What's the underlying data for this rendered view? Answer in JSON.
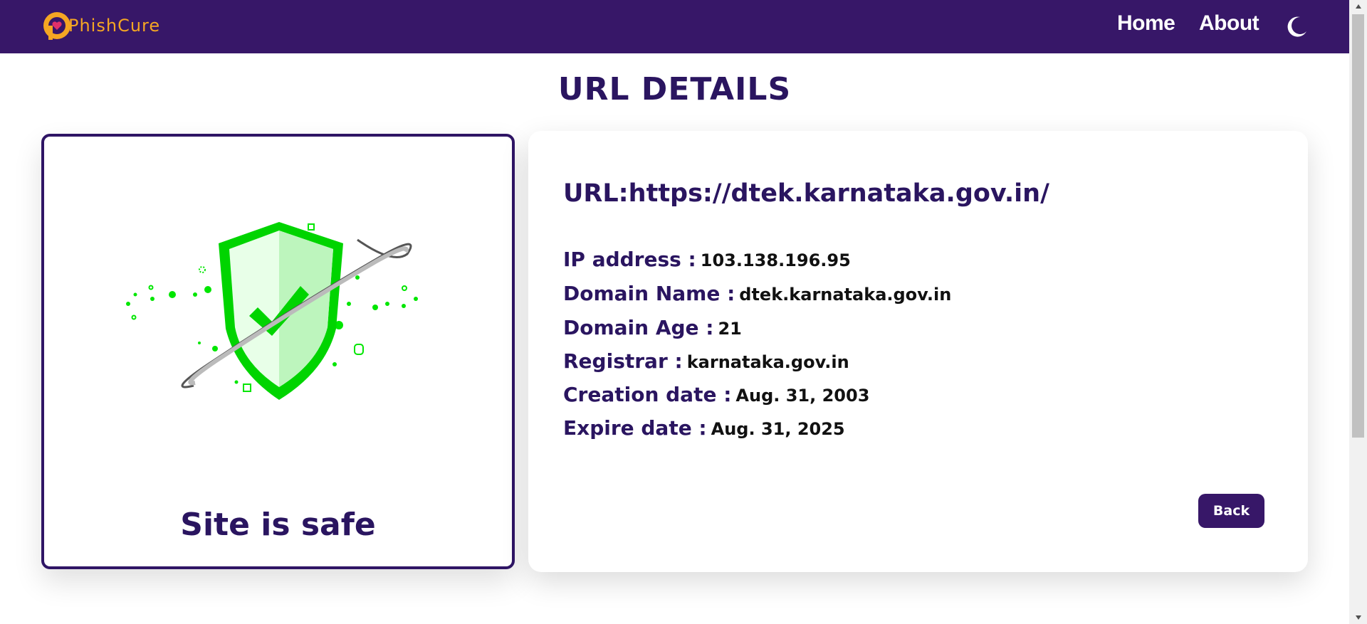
{
  "navbar": {
    "logo_text": "PhishCure",
    "home_label": "Home",
    "about_label": "About",
    "theme_icon": "moon-icon",
    "background_color": "#371768",
    "logo_color": "#f5a623"
  },
  "page": {
    "title": "URL DETAILS"
  },
  "status_card": {
    "illustration_icon": "shield-check-icon",
    "status_text": "Site is safe",
    "accent_color": "#00e600"
  },
  "details": {
    "url_label": "URL:",
    "url_value": "https://dtek.karnataka.gov.in/",
    "rows": [
      {
        "label": "IP address :",
        "value": "103.138.196.95"
      },
      {
        "label": "Domain Name :",
        "value": "dtek.karnataka.gov.in"
      },
      {
        "label": "Domain Age :",
        "value": "21"
      },
      {
        "label": "Registrar :",
        "value": "karnataka.gov.in"
      },
      {
        "label": "Creation date :",
        "value": "Aug. 31, 2003"
      },
      {
        "label": "Expire date :",
        "value": "Aug. 31, 2025"
      }
    ],
    "back_label": "Back"
  }
}
